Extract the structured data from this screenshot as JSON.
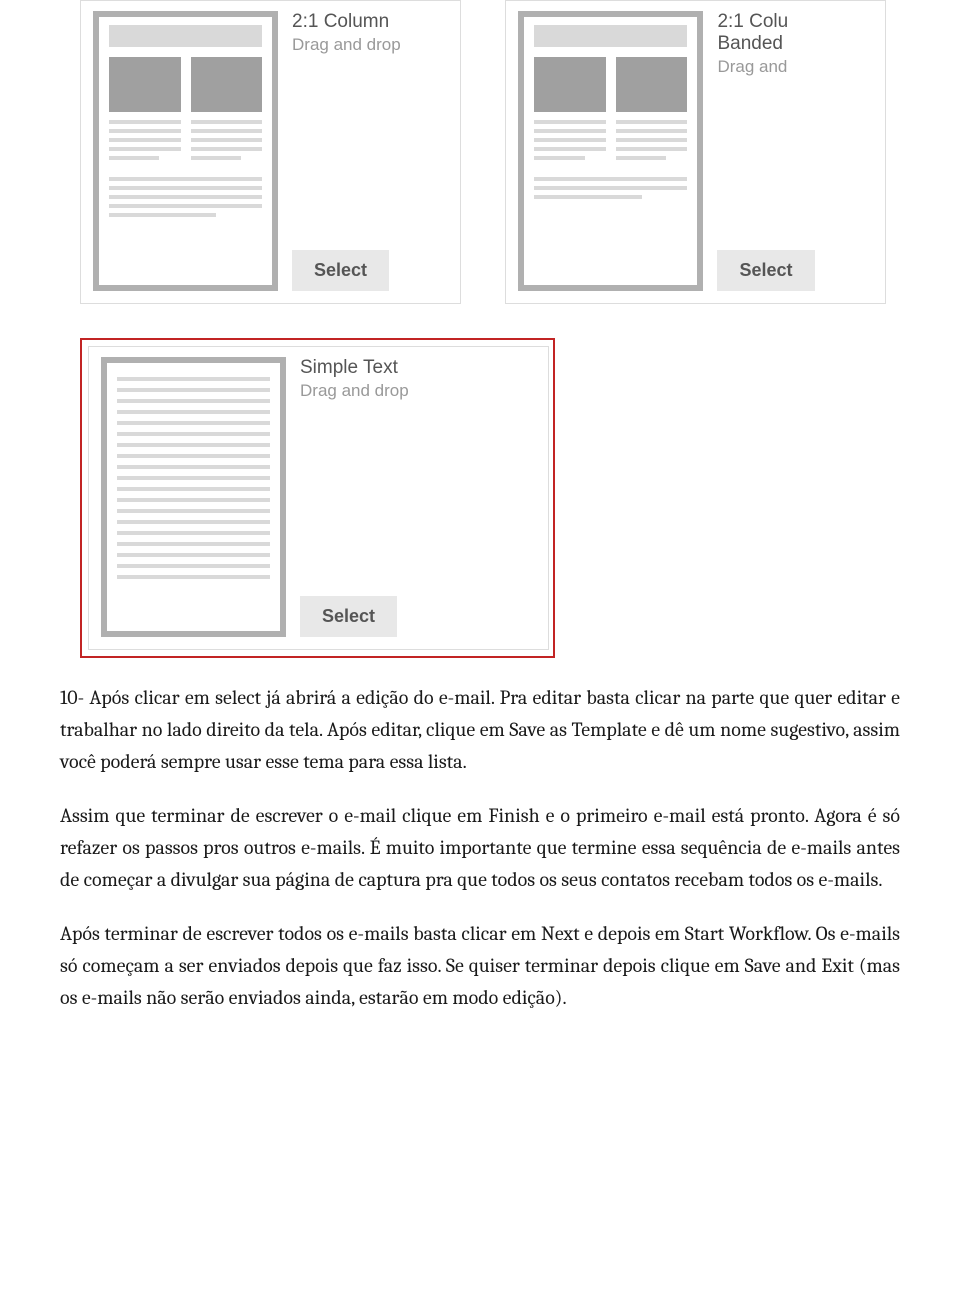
{
  "templates": {
    "card1": {
      "title": "2:1 Column",
      "subtitle": "Drag and drop",
      "button": "Select"
    },
    "card2": {
      "title": "2:1 Colu",
      "subtitle_line1": "Banded",
      "subtitle_line2": "Drag and",
      "button": "Select"
    },
    "card3": {
      "title": "Simple Text",
      "subtitle": "Drag and drop",
      "button": "Select"
    }
  },
  "body": {
    "p1": "10- Após clicar em select já abrirá a edição do e-mail. Pra editar basta clicar na parte que quer editar e trabalhar no lado direito da tela. Após editar, clique em Save as Template e dê um nome sugestivo, assim você poderá sempre usar esse tema para essa lista.",
    "p2": "Assim que terminar de escrever o e-mail clique em Finish e o primeiro e-mail está pronto. Agora é só refazer os passos pros outros e-mails. É muito importante que termine essa sequência de e-mails antes de começar a divulgar sua página de captura pra que todos os seus contatos recebam todos os e-mails.",
    "p3": "Após terminar de escrever todos os e-mails basta clicar em Next e depois em Start Workflow. Os e-mails só começam a ser enviados depois que faz isso. Se quiser terminar depois clique em Save and Exit (mas os e-mails não serão enviados ainda, estarão em modo edição)."
  }
}
